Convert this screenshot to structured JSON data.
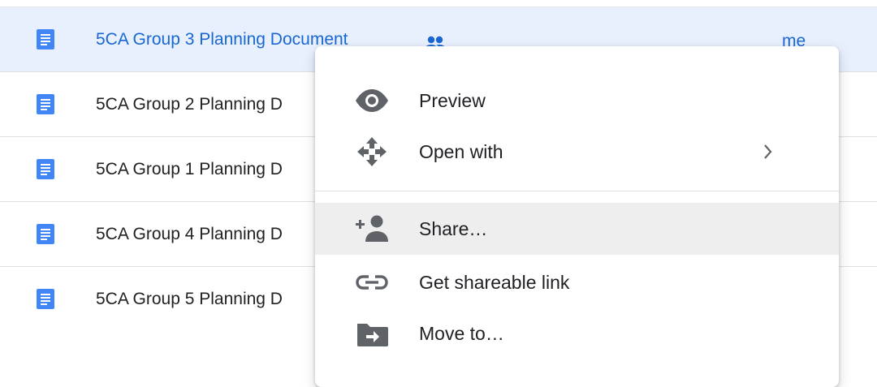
{
  "files": [
    {
      "name": "5CA Group 3 Planning Document",
      "owner": "me",
      "selected": true,
      "shared": true,
      "icon": "docs-icon"
    },
    {
      "name": "5CA Group 2 Planning D",
      "owner": "",
      "selected": false,
      "shared": false,
      "icon": "docs-icon"
    },
    {
      "name": "5CA Group 1 Planning D",
      "owner": "",
      "selected": false,
      "shared": false,
      "icon": "docs-icon"
    },
    {
      "name": "5CA Group 4 Planning D",
      "owner": "",
      "selected": false,
      "shared": false,
      "icon": "docs-icon"
    },
    {
      "name": "5CA Group 5 Planning D",
      "owner": "",
      "selected": false,
      "shared": false,
      "icon": "docs-icon"
    }
  ],
  "context_menu": {
    "items": [
      {
        "label": "Preview",
        "icon": "eye-icon",
        "has_submenu": false,
        "highlighted": false
      },
      {
        "label": "Open with",
        "icon": "move-arrows-icon",
        "has_submenu": true,
        "highlighted": false
      },
      {
        "label": "Share…",
        "icon": "person-add-icon",
        "has_submenu": false,
        "highlighted": true
      },
      {
        "label": "Get shareable link",
        "icon": "link-icon",
        "has_submenu": false,
        "highlighted": false
      },
      {
        "label": "Move to…",
        "icon": "folder-move-icon",
        "has_submenu": false,
        "highlighted": false
      }
    ]
  },
  "colors": {
    "doc_blue": "#4285f4",
    "selected_row": "#e8f0fe",
    "selected_text": "#1967d2",
    "icon_gray": "#5f6368",
    "hover_gray": "#eeeeee"
  }
}
